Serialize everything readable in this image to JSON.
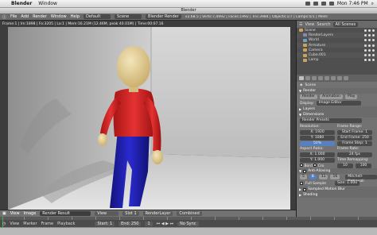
{
  "mac_menu": {
    "app": "Blender",
    "items": [
      "Window"
    ],
    "clock": "Mon 7:46 PM"
  },
  "window_title": "Blender",
  "info_header": {
    "menus": [
      "File",
      "Add",
      "Render",
      "Window",
      "Help"
    ],
    "screen": "Default",
    "scene": "Scene",
    "engine": "Blender Render",
    "stats": "v2.68.5 | Verts:7,4992 | Faces:1992 | Tris:3984 | Objects:1/7 | Lamps:0/1 | Mem:"
  },
  "viewport": {
    "info": "Frame:1 | Im:1898 | Fo:3205 | La:1 | Mem:16.21M (12.46M, peak 40.01M) | Time:00:07.16"
  },
  "image_header": {
    "menus": [
      "View",
      "Image"
    ],
    "image": "Render Result",
    "view": "View",
    "slot": "Slot 1",
    "layer": "RenderLayer",
    "pass": "Combined"
  },
  "timeline": {
    "menus": [
      "View",
      "Marker",
      "Frame",
      "Playback"
    ],
    "start": "Start: 1",
    "end": "End: 250",
    "current": "1",
    "sync": "No Sync"
  },
  "outliner": {
    "header_view": "View",
    "header_search": "Search",
    "header_scenes": "All Scenes",
    "rows": [
      {
        "label": "Scene",
        "color": "#c9a55c"
      },
      {
        "label": "RenderLayers",
        "color": "#8a8ab0"
      },
      {
        "label": "World",
        "color": "#6fa0c8"
      },
      {
        "label": "Armature",
        "color": "#c9a55c"
      },
      {
        "label": "Camera",
        "color": "#c9a55c"
      },
      {
        "label": "Cube.001",
        "color": "#c9a55c"
      },
      {
        "label": "Lamp",
        "color": "#c9a55c"
      }
    ]
  },
  "properties": {
    "context": "Scene",
    "render_section": "Render",
    "buttons": [
      "Render",
      "Animation",
      "Play"
    ],
    "display_label": "Display:",
    "display_value": "Image Editor",
    "layers": "Layers",
    "dimensions": "Dimensions",
    "presets": "Render Presets",
    "resolution": "Resolution:",
    "res_x": "X: 1920",
    "res_y": "Y: 1080",
    "res_pct": "50%",
    "frame_range": "Frame Range:",
    "start_frame": "Start Frame: 1",
    "end_frame": "End Frame: 250",
    "frame_step": "Frame Step: 1",
    "aspect": "Aspect Ratio:",
    "asp_x": "X: 1.000",
    "asp_y": "Y: 1.000",
    "frame_rate": "Frame Rate:",
    "fps": "24 fps",
    "time_remap": "Time Remapping:",
    "border": "Bord",
    "crop": "Cro",
    "old": "10",
    "new": "100",
    "anti_aliasing": "Anti-Aliasing",
    "aa_samples": [
      "5",
      "8",
      "11",
      "16"
    ],
    "aa_filter": "Mitchell-Netravali",
    "full_sample": "Full Sample",
    "aa_size": "Size: 1.000",
    "motion_blur": "Sampled Motion Blur",
    "shading": "Shading"
  },
  "colors": {
    "shirt": "#d42a2a",
    "pants": "#1f1fb8",
    "skin": "#e6d09a",
    "accent": "#5680c2"
  }
}
